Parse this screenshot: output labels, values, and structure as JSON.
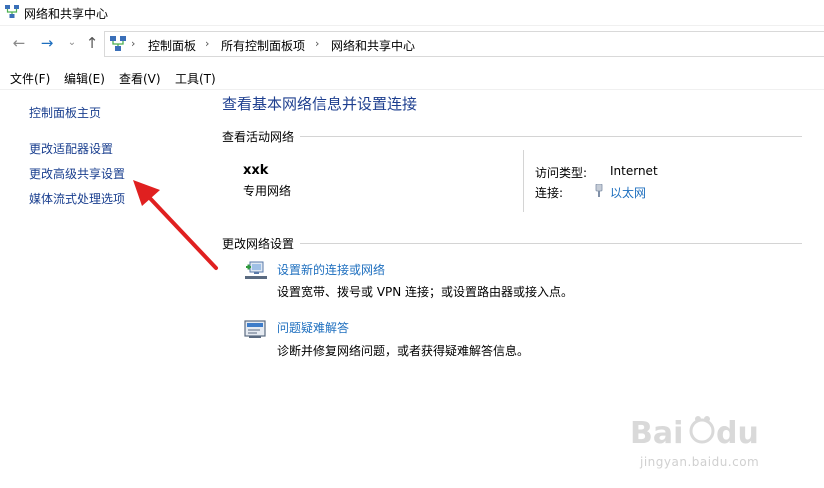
{
  "window": {
    "title": "网络和共享中心"
  },
  "address": {
    "crumbs": [
      "控制面板",
      "所有控制面板项",
      "网络和共享中心"
    ]
  },
  "menu": {
    "items": [
      "文件(F)",
      "编辑(E)",
      "查看(V)",
      "工具(T)"
    ]
  },
  "left_pane": {
    "items": [
      "控制面板主页",
      "更改适配器设置",
      "更改高级共享设置",
      "媒体流式处理选项"
    ]
  },
  "main": {
    "heading": "查看基本网络信息并设置连接",
    "active_section": "查看活动网络",
    "network": {
      "name": "xxk",
      "type": "专用网络",
      "access_label": "访问类型:",
      "access_value": "Internet",
      "conn_label": "连接:",
      "conn_value": "以太网"
    },
    "change_section": "更改网络设置",
    "tasks": [
      {
        "link": "设置新的连接或网络",
        "desc": "设置宽带、拨号或 VPN 连接；或设置路由器或接入点。",
        "icon": "new-connection-icon"
      },
      {
        "link": "问题疑难解答",
        "desc": "诊断并修复网络问题，或者获得疑难解答信息。",
        "icon": "troubleshoot-icon"
      }
    ]
  },
  "watermark": {
    "text": "jingyan.baidu.com"
  },
  "colors": {
    "link": "#1e6fbf",
    "heading": "#1e3f8f",
    "nav_link": "#1a3f8f",
    "arrow": "#e02020"
  }
}
